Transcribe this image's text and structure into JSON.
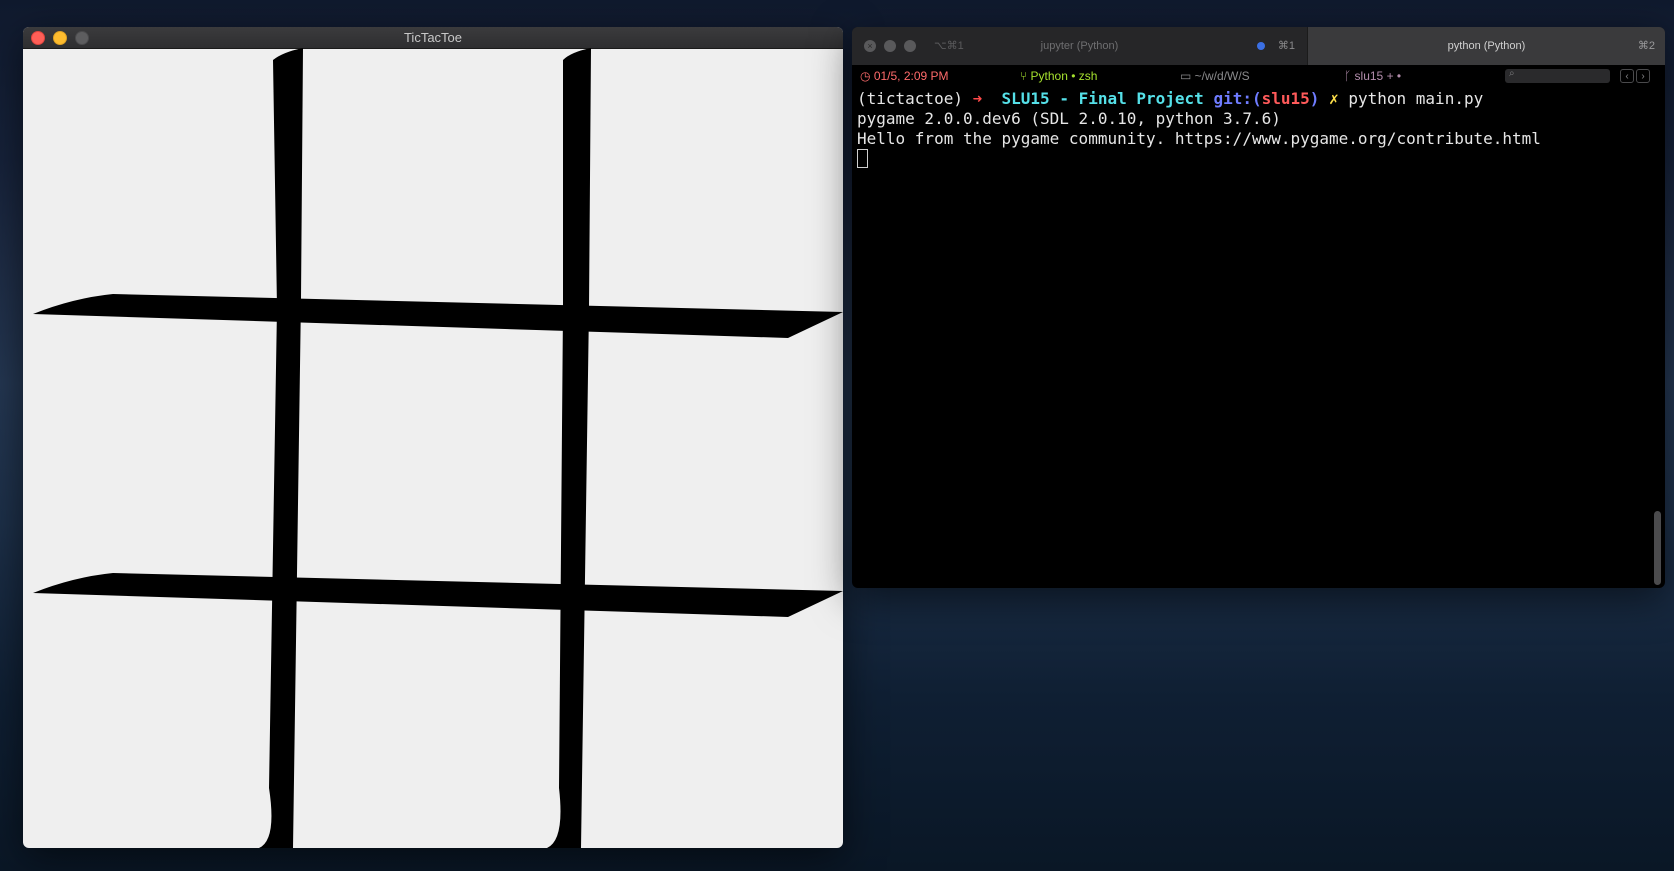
{
  "game_window": {
    "title": "TicTacToe"
  },
  "terminal": {
    "tabs": [
      {
        "label": "jupyter (Python)",
        "shortcut_left": "⌥⌘1",
        "shortcut_right": "⌘1"
      },
      {
        "label": "python (Python)",
        "shortcut_right": "⌘2"
      }
    ],
    "status": {
      "time": "01/5, 2:09 PM",
      "process": "Python • zsh",
      "directory": "~/w/d/W/S",
      "git": "slu15 + •"
    },
    "prompt": {
      "env": "(tictactoe)",
      "arrow": "➜",
      "dir": "SLU15 - Final Project",
      "git_prefix": "git:(",
      "branch": "slu15",
      "git_suffix": ")",
      "dirty": "✗",
      "command": "python main.py"
    },
    "output": [
      "pygame 2.0.0.dev6 (SDL 2.0.10, python 3.7.6)",
      "Hello from the pygame community. https://www.pygame.org/contribute.html"
    ]
  },
  "colors": {
    "board_bg": "#efefef",
    "grid_lines": "#000000",
    "terminal_bg": "#000000"
  }
}
